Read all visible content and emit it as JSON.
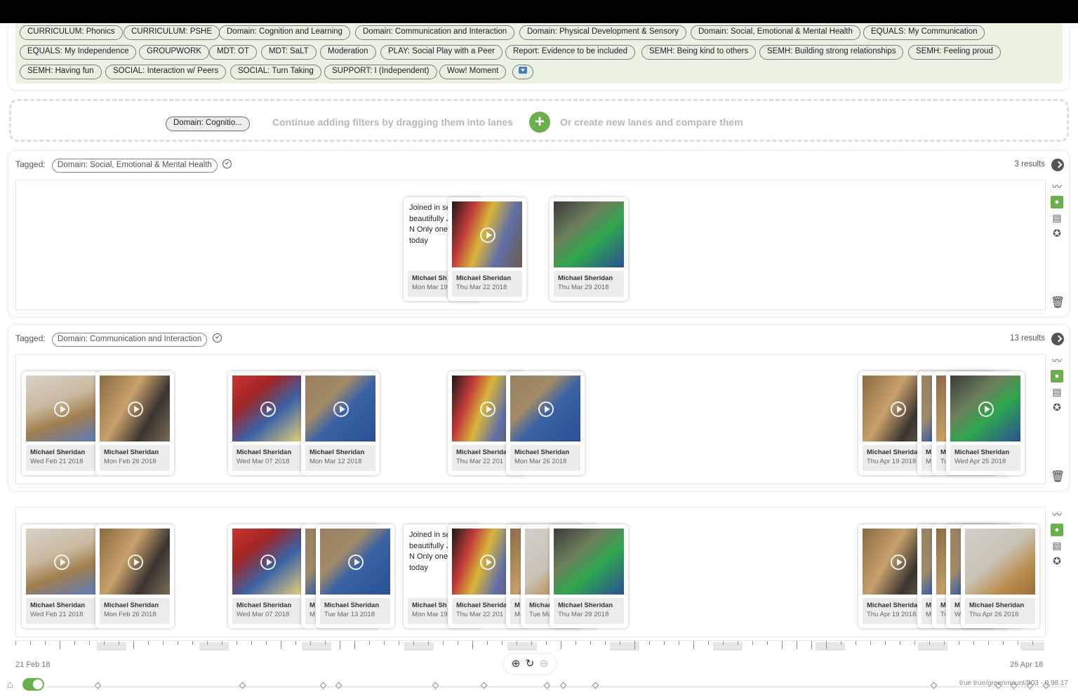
{
  "tags": [
    "CURRICULUM: Phonics",
    "CURRICULUM: PSHE",
    "Domain: Cognition and Learning",
    "Domain: Communication and Interaction",
    "Domain: Physical Development & Sensory",
    "Domain: Social, Emotional & Mental Health",
    "EQUALS: My Communication",
    "EQUALS: My Independence",
    "GROUPWORK",
    "MDT: OT",
    "MDT: SaLT",
    "Moderation",
    "PLAY: Social Play with a Peer",
    "Report: Evidence to be included",
    "SEMH: Being kind to others",
    "SEMH: Building strong relationships",
    "SEMH: Feeling proud",
    "SEMH: Having fun",
    "SOCIAL: Interaction w/ Peers",
    "SOCIAL: Turn Taking",
    "SUPPORT: I (Independent)",
    "Wow! Moment"
  ],
  "droplane": {
    "chip": "Domain: Cognitio...",
    "hint1": "Continue adding filters by dragging them into lanes",
    "plus": "+",
    "hint2": "Or create new lanes and compare them"
  },
  "lanes": [
    {
      "tagged_label": "Tagged:",
      "tag": "Domain: Social, Emotional & Mental Health",
      "results": "3 results"
    },
    {
      "tagged_label": "Tagged:",
      "tag": "Domain: Communication and Interaction",
      "results": "13 results"
    }
  ],
  "note_text": "Joined in sensology beautifully JS today N Only one c peer today",
  "cards": {
    "l1": [
      {
        "name": "Michael Sh",
        "date": "Mon Mar 19"
      },
      {
        "name": "Michael Sheridan",
        "date": "Thu Mar 22 2018"
      },
      {
        "name": "Michael Sheridan",
        "date": "Thu Mar 29 2018"
      }
    ],
    "l2": [
      {
        "name": "Michael Sheridan",
        "date": "Wed Feb 21 2018"
      },
      {
        "name": "Michael Sheridan",
        "date": "Mon Feb 26 2018"
      },
      {
        "name": "Michael Sheridan",
        "date": "Wed Mar 07 2018"
      },
      {
        "name": "Michael Sheridan",
        "date": "Mon Mar 12 2018"
      },
      {
        "name": "Michael Sherida",
        "date": "Thu Mar 22 201"
      },
      {
        "name": "Michael Sheridan",
        "date": "Mon Mar 26 2018"
      },
      {
        "name": "Michael Sherida",
        "date": "Thu Apr 19 2018"
      },
      {
        "name": "M",
        "date": "M"
      },
      {
        "name": "M",
        "date": "Tu"
      },
      {
        "name": "Michael Sheridan",
        "date": "Wed Apr 25 2018"
      }
    ],
    "l3": [
      {
        "name": "Michael Sheridan",
        "date": "Wed Feb 21 2018"
      },
      {
        "name": "Michael Sheridan",
        "date": "Mon Feb 26 2018"
      },
      {
        "name": "Michael Sheridan",
        "date": "Wed Mar 07 2018"
      },
      {
        "name": "M",
        "date": "M"
      },
      {
        "name": "Michael Sheridan",
        "date": "Tue Mar 13 2018"
      },
      {
        "name": "Michael Sh",
        "date": "Mon Mar 19"
      },
      {
        "name": "Michael Sherida",
        "date": "Thu Mar 22 201"
      },
      {
        "name": "M",
        "date": "M"
      },
      {
        "name": "Michae",
        "date": "Tue Ma"
      },
      {
        "name": "Michael Sheridan",
        "date": "Thu Mar 29 2018"
      },
      {
        "name": "Michael Sherida",
        "date": "Thu Apr 19 2018"
      },
      {
        "name": "M",
        "date": "M"
      },
      {
        "name": "M",
        "date": "Tu"
      },
      {
        "name": "M",
        "date": "W"
      },
      {
        "name": "Michael Sheridan",
        "date": "Thu Apr 26 2018"
      }
    ]
  },
  "timeline": {
    "start": "21 Feb 18",
    "end": "25 Apr 18"
  },
  "version": "true true/greenmount/803 - 0.98.17",
  "colors": {
    "accent": "#6ab04c",
    "tag_bg": "#eaf3e1"
  },
  "icons": [
    "trend-icon",
    "person-icon",
    "comment-icon",
    "star-icon",
    "trash-icon",
    "zoom-in-icon",
    "reset-icon",
    "zoom-out-icon",
    "home-icon",
    "next-icon",
    "play-icon"
  ]
}
